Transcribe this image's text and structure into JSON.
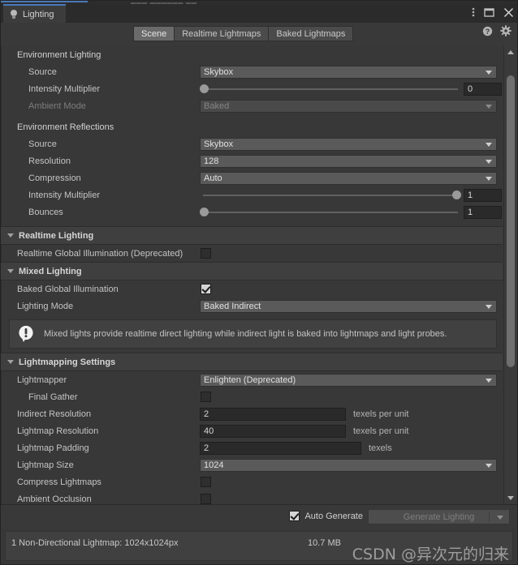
{
  "window": {
    "tab_title": "Lighting",
    "ghost_text": "▄▄▄ ▄▄▄▄▄▄ ▄▄",
    "controls": {
      "menu": "kebab-menu",
      "maximize": "maximize",
      "close": "close"
    }
  },
  "toolbar": {
    "tabs": [
      {
        "label": "Scene",
        "active": true
      },
      {
        "label": "Realtime Lightmaps",
        "active": false
      },
      {
        "label": "Baked Lightmaps",
        "active": false
      }
    ],
    "help_icon": "help-icon",
    "settings_icon": "gear-icon"
  },
  "environment_lighting": {
    "title": "Environment Lighting",
    "source": {
      "label": "Source",
      "value": "Skybox"
    },
    "intensity_multiplier": {
      "label": "Intensity Multiplier",
      "value": "0",
      "slider_pct": 0
    },
    "ambient_mode": {
      "label": "Ambient Mode",
      "value": "Baked",
      "disabled": true
    }
  },
  "environment_reflections": {
    "title": "Environment Reflections",
    "source": {
      "label": "Source",
      "value": "Skybox"
    },
    "resolution": {
      "label": "Resolution",
      "value": "128"
    },
    "compression": {
      "label": "Compression",
      "value": "Auto"
    },
    "intensity_multiplier": {
      "label": "Intensity Multiplier",
      "value": "1",
      "slider_pct": 100
    },
    "bounces": {
      "label": "Bounces",
      "value": "1",
      "slider_pct": 0
    }
  },
  "realtime_lighting": {
    "title": "Realtime Lighting",
    "realtime_gi": {
      "label": "Realtime Global Illumination (Deprecated)",
      "checked": false
    }
  },
  "mixed_lighting": {
    "title": "Mixed Lighting",
    "baked_gi": {
      "label": "Baked Global Illumination",
      "checked": true
    },
    "lighting_mode": {
      "label": "Lighting Mode",
      "value": "Baked Indirect"
    },
    "info": "Mixed lights provide realtime direct lighting while indirect light is baked into lightmaps and light probes."
  },
  "lightmapping_settings": {
    "title": "Lightmapping Settings",
    "lightmapper": {
      "label": "Lightmapper",
      "value": "Enlighten (Deprecated)"
    },
    "final_gather": {
      "label": "Final Gather",
      "checked": false
    },
    "indirect_resolution": {
      "label": "Indirect Resolution",
      "value": "2",
      "unit": "texels per unit"
    },
    "lightmap_resolution": {
      "label": "Lightmap Resolution",
      "value": "40",
      "unit": "texels per unit"
    },
    "lightmap_padding": {
      "label": "Lightmap Padding",
      "value": "2",
      "unit": "texels"
    },
    "lightmap_size": {
      "label": "Lightmap Size",
      "value": "1024"
    },
    "compress_lightmaps": {
      "label": "Compress Lightmaps",
      "checked": false
    },
    "ambient_occlusion": {
      "label": "Ambient Occlusion",
      "checked": false
    }
  },
  "footer": {
    "auto_generate": {
      "label": "Auto Generate",
      "checked": true
    },
    "generate_button": "Generate Lighting"
  },
  "status": {
    "lightmap_info": "1 Non-Directional Lightmap: 1024x1024px",
    "size": "10.7 MB"
  },
  "watermark": "CSDN @异次元的归来",
  "colors": {
    "accent_blue": "#4a78b8",
    "panel_bg": "#383838",
    "field_bg": "#2a2a2a",
    "dropdown_bg": "#5a5a5a"
  }
}
